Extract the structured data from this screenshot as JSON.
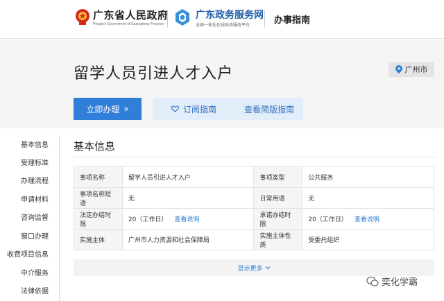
{
  "header": {
    "gov_name": "广东省人民政府",
    "gov_name_en": "People's Government of Guangdong Province",
    "service_name": "广东政务服务网",
    "service_tagline": "全国一体化在线政务服务平台",
    "page_kind": "办事指南"
  },
  "page": {
    "title": "留学人员引进人才入户",
    "city": "广州市"
  },
  "actions": {
    "apply": "立即办理",
    "apply_arrow": "»",
    "subscribe": "订阅指南",
    "simple": "查看简版指南"
  },
  "sidenav": {
    "items": [
      "基本信息",
      "受理标准",
      "办理流程",
      "申请材料",
      "咨询监督",
      "窗口办理",
      "收费项目信息",
      "中介服务",
      "法律依据"
    ]
  },
  "basic_info": {
    "section_title": "基本信息",
    "rows": [
      {
        "k1": "事项名称",
        "v1": "留学人员引进人才入户",
        "k2": "事项类型",
        "v2": "公共服务"
      },
      {
        "k1": "事项名称短语",
        "v1": "无",
        "k2": "日常用语",
        "v2": "无"
      },
      {
        "k1": "法定办结时限",
        "v1": "20（工作日）",
        "l1": "查看说明",
        "k2": "承诺办结时限",
        "v2": "20（工作日）",
        "l2": "查看说明"
      },
      {
        "k1": "实施主体",
        "v1": "广州市人力资源和社会保障局",
        "k2": "实施主体性质",
        "v2": "受委托组织"
      }
    ],
    "show_more": "显示更多"
  },
  "watermark": "奕化学霸",
  "colors": {
    "primary": "#2f7ed8",
    "light_button": "#e2edfa",
    "band": "#f4f4f4"
  }
}
